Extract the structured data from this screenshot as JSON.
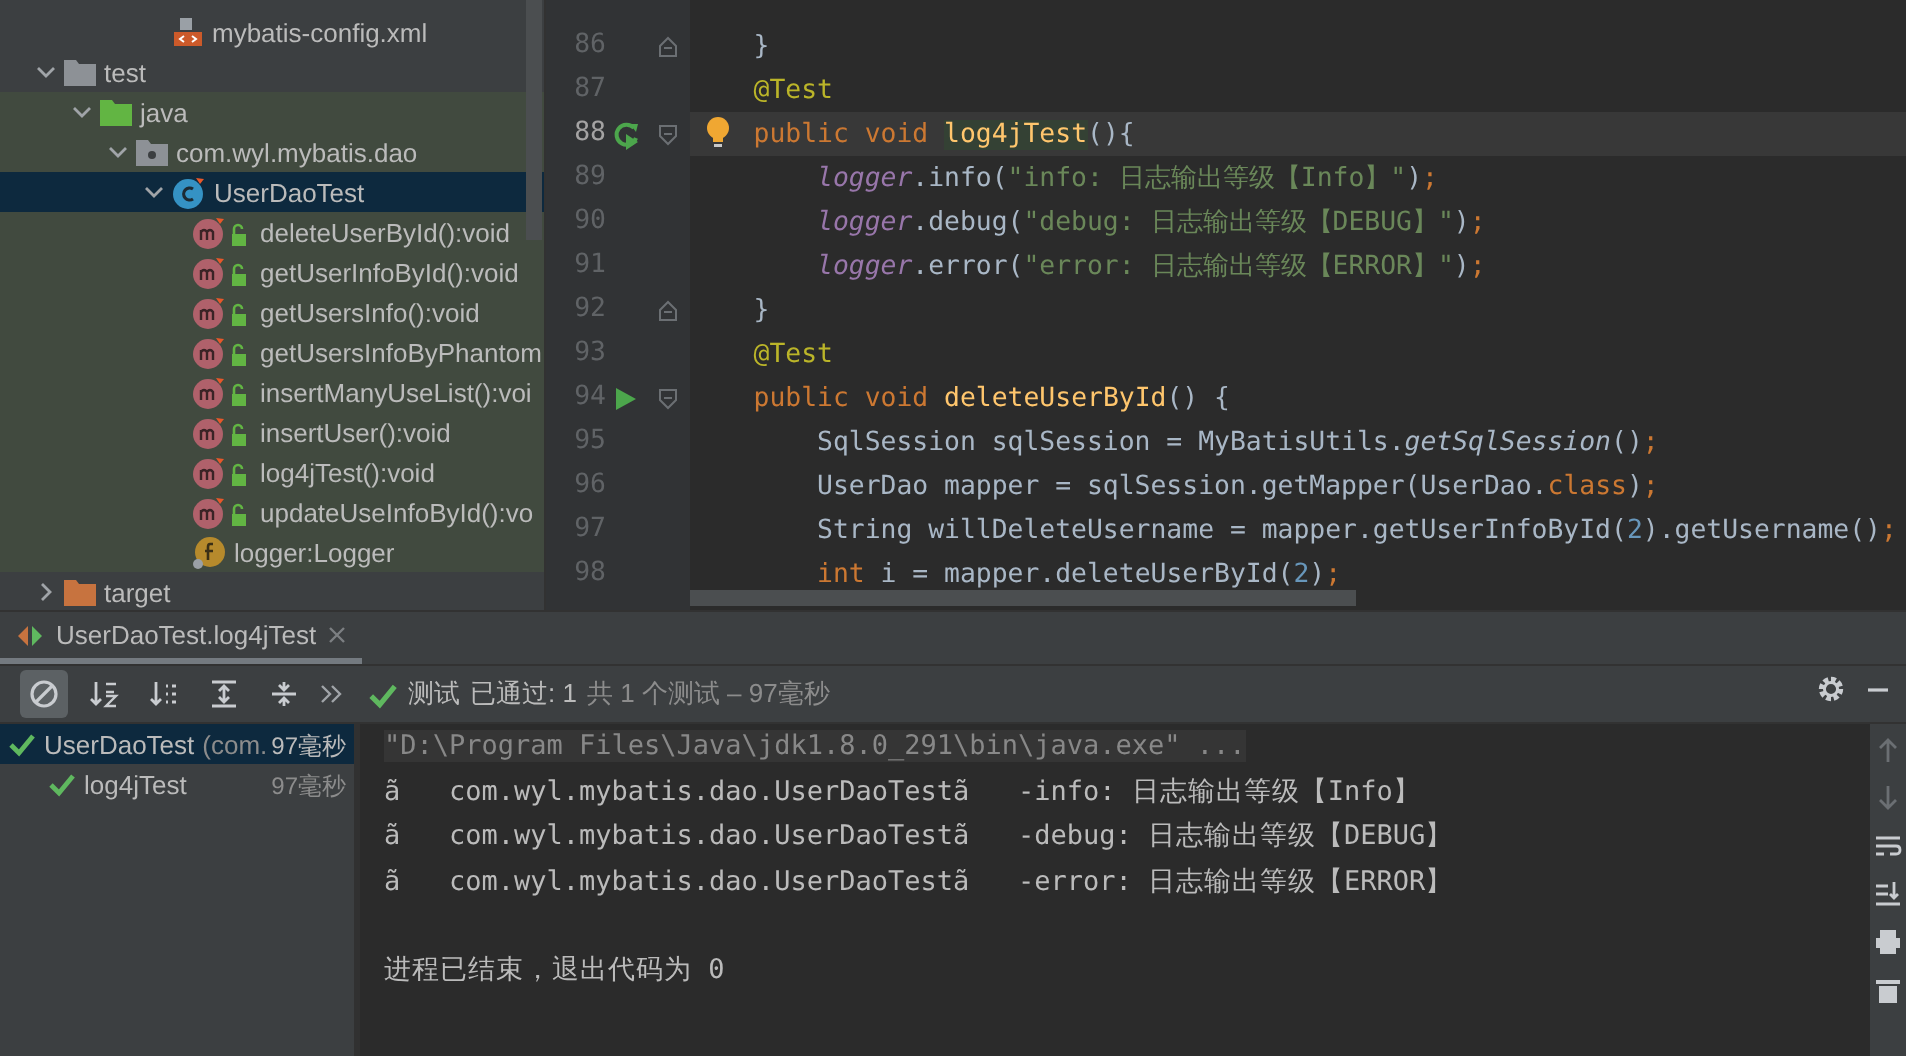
{
  "project_tree": {
    "items": [
      {
        "kind": "xml",
        "label": "mybatis-config.xml",
        "selected": false
      },
      {
        "kind": "folder",
        "label": "test",
        "expanded": true,
        "selected": false,
        "children": [
          {
            "kind": "test-root",
            "label": "java",
            "expanded": true,
            "selected": false,
            "children": [
              {
                "kind": "package",
                "label": "com.wyl.mybatis.dao",
                "expanded": true,
                "selected": false,
                "children": [
                  {
                    "kind": "class",
                    "label": "UserDaoTest",
                    "expanded": true,
                    "selected": true,
                    "children": [
                      {
                        "kind": "method",
                        "label": "deleteUserById():void",
                        "selected": false
                      },
                      {
                        "kind": "method",
                        "label": "getUserInfoById():void",
                        "selected": false
                      },
                      {
                        "kind": "method",
                        "label": "getUsersInfo():void",
                        "selected": false
                      },
                      {
                        "kind": "method",
                        "label": "getUsersInfoByPhantom",
                        "selected": false
                      },
                      {
                        "kind": "method",
                        "label": "insertManyUseList():voi",
                        "selected": false
                      },
                      {
                        "kind": "method",
                        "label": "insertUser():void",
                        "selected": false
                      },
                      {
                        "kind": "method",
                        "label": "log4jTest():void",
                        "selected": false
                      },
                      {
                        "kind": "method",
                        "label": "updateUseInfoById():vo",
                        "selected": false
                      },
                      {
                        "kind": "field",
                        "label": "logger:Logger",
                        "selected": false
                      }
                    ]
                  }
                ]
              }
            ]
          }
        ]
      },
      {
        "kind": "excluded",
        "label": "target",
        "expanded": false,
        "selected": false
      }
    ]
  },
  "editor": {
    "lines": [
      {
        "number": "86",
        "current": false,
        "gutter": [
          {
            "kind": "fold-end"
          }
        ],
        "tokens": [
          {
            "kind": "plain",
            "text": "    }"
          }
        ]
      },
      {
        "number": "87",
        "current": false,
        "tokens": [
          {
            "kind": "annotation",
            "text": "    @Test"
          }
        ]
      },
      {
        "number": "88",
        "current": true,
        "gutter": [
          {
            "kind": "rerun"
          },
          {
            "kind": "fold-start"
          },
          {
            "kind": "bulb"
          }
        ],
        "tokens": [
          {
            "kind": "keyword",
            "text": "    public void "
          },
          {
            "kind": "highlight",
            "text": "log4jTest"
          },
          {
            "kind": "plain",
            "text": "(){"
          }
        ]
      },
      {
        "number": "89",
        "current": false,
        "tokens": [
          {
            "kind": "field",
            "text": "        logger"
          },
          {
            "kind": "plain",
            "text": ".info("
          },
          {
            "kind": "string",
            "text": "\"info: 日志输出等级【Info】\""
          },
          {
            "kind": "plain",
            "text": ")"
          },
          {
            "kind": "keyword",
            "text": ";"
          }
        ]
      },
      {
        "number": "90",
        "current": false,
        "tokens": [
          {
            "kind": "field",
            "text": "        logger"
          },
          {
            "kind": "plain",
            "text": ".debug("
          },
          {
            "kind": "string",
            "text": "\"debug: 日志输出等级【DEBUG】\""
          },
          {
            "kind": "plain",
            "text": ")"
          },
          {
            "kind": "keyword",
            "text": ";"
          }
        ]
      },
      {
        "number": "91",
        "current": false,
        "tokens": [
          {
            "kind": "field",
            "text": "        logger"
          },
          {
            "kind": "plain",
            "text": ".error("
          },
          {
            "kind": "string",
            "text": "\"error: 日志输出等级【ERROR】\""
          },
          {
            "kind": "plain",
            "text": ")"
          },
          {
            "kind": "keyword",
            "text": ";"
          }
        ]
      },
      {
        "number": "92",
        "current": false,
        "gutter": [
          {
            "kind": "fold-end"
          }
        ],
        "tokens": [
          {
            "kind": "plain",
            "text": "    }"
          }
        ]
      },
      {
        "number": "93",
        "current": false,
        "tokens": [
          {
            "kind": "annotation",
            "text": "    @Test"
          }
        ]
      },
      {
        "number": "94",
        "current": false,
        "gutter": [
          {
            "kind": "run"
          },
          {
            "kind": "fold-start"
          }
        ],
        "tokens": [
          {
            "kind": "keyword",
            "text": "    public void "
          },
          {
            "kind": "function",
            "text": "deleteUserById"
          },
          {
            "kind": "plain",
            "text": "() {"
          }
        ]
      },
      {
        "number": "95",
        "current": false,
        "tokens": [
          {
            "kind": "plain",
            "text": "        SqlSession sqlSession = MyBatisUtils."
          },
          {
            "kind": "static",
            "text": "getSqlSession"
          },
          {
            "kind": "plain",
            "text": "()"
          },
          {
            "kind": "keyword",
            "text": ";"
          }
        ]
      },
      {
        "number": "96",
        "current": false,
        "tokens": [
          {
            "kind": "plain",
            "text": "        UserDao mapper = sqlSession.getMapper(UserDao."
          },
          {
            "kind": "keyword",
            "text": "class"
          },
          {
            "kind": "plain",
            "text": ")"
          },
          {
            "kind": "keyword",
            "text": ";"
          }
        ]
      },
      {
        "number": "97",
        "current": false,
        "tokens": [
          {
            "kind": "plain",
            "text": "        String willDeleteUsername = mapper.getUserInfoById("
          },
          {
            "kind": "number",
            "text": "2"
          },
          {
            "kind": "plain",
            "text": ").getUsername()"
          },
          {
            "kind": "keyword",
            "text": ";"
          }
        ]
      },
      {
        "number": "98",
        "current": false,
        "tokens": [
          {
            "kind": "keyword",
            "text": "        int"
          },
          {
            "kind": "plain",
            "text": " i = mapper.deleteUserById("
          },
          {
            "kind": "number",
            "text": "2"
          },
          {
            "kind": "plain",
            "text": ")"
          },
          {
            "kind": "keyword",
            "text": ";"
          }
        ]
      }
    ]
  },
  "run_panel": {
    "tab": {
      "label": "UserDaoTest.log4jTest",
      "selected": true
    },
    "toolbar": [
      {
        "selected": true
      },
      {
        "selected": false
      },
      {
        "selected": false
      },
      {
        "selected": false
      },
      {
        "selected": false
      }
    ],
    "status": {
      "passed": true,
      "label": "测试",
      "result": "已通过: 1",
      "summary": "共 1 个测试 – 97毫秒"
    },
    "tests": [
      {
        "label": "UserDaoTest",
        "detail": "(com.",
        "time": "97毫秒",
        "passed": true,
        "selected": true,
        "children": [
          {
            "label": "log4jTest",
            "time": "97毫秒",
            "passed": true,
            "selected": false
          }
        ]
      }
    ],
    "console": [
      {
        "kind": "command",
        "text": "\"D:\\Program Files\\Java\\jdk1.8.0_291\\bin\\java.exe\" ..."
      },
      {
        "kind": "log",
        "text": "ã   com.wyl.mybatis.dao.UserDaoTestã   -info: 日志输出等级【Info】"
      },
      {
        "kind": "log",
        "text": "ã   com.wyl.mybatis.dao.UserDaoTestã   -debug: 日志输出等级【DEBUG】"
      },
      {
        "kind": "log",
        "text": "ã   com.wyl.mybatis.dao.UserDaoTestã   -error: 日志输出等级【ERROR】"
      },
      {
        "kind": "exit",
        "text": "进程已结束，退出代码为 0"
      }
    ]
  }
}
